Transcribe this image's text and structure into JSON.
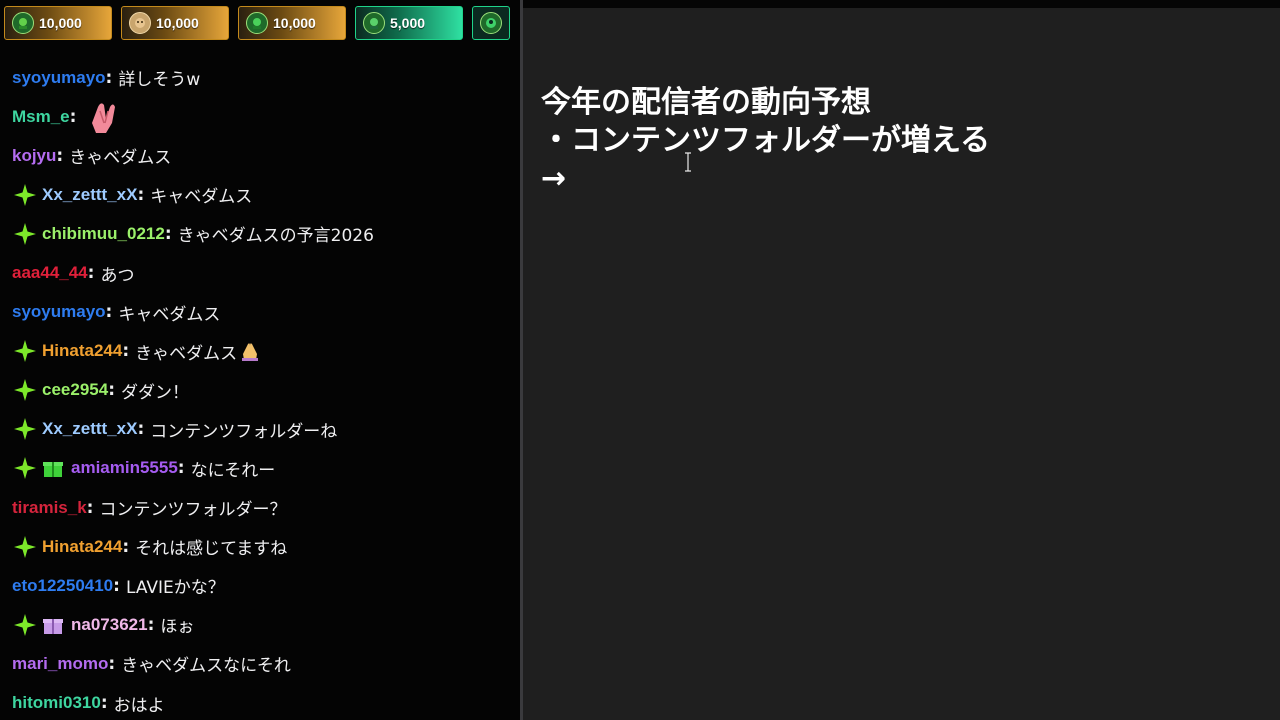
{
  "leaderboard": [
    {
      "count": "10,000",
      "style": "gold"
    },
    {
      "count": "10,000",
      "style": "gold"
    },
    {
      "count": "10,000",
      "style": "gold"
    },
    {
      "count": "5,000",
      "style": "green"
    }
  ],
  "messages": [
    {
      "user": "syoyumayo",
      "color": "#2e7cf0",
      "text": "詳しそうw",
      "badge": false,
      "gift": null
    },
    {
      "user": "Msm_e",
      "color": "#3ed6a0",
      "text": "",
      "badge": false,
      "gift": null,
      "emote": "praying-hands-emote"
    },
    {
      "user": "kojyu",
      "color": "#b46cf0",
      "text": "きゃベダムス",
      "badge": false,
      "gift": null
    },
    {
      "user": "Xx_zettt_xX",
      "color": "#9ecbff",
      "text": "キャベダムス",
      "badge": true,
      "gift": null
    },
    {
      "user": "chibimuu_0212",
      "color": "#9bf06a",
      "text": "きゃベダムスの予言2026",
      "badge": true,
      "gift": null
    },
    {
      "user": "aaa44_44",
      "color": "#e0203a",
      "text": "あつ",
      "badge": false,
      "gift": null
    },
    {
      "user": "syoyumayo",
      "color": "#2e7cf0",
      "text": "キャベダムス",
      "badge": false,
      "gift": null
    },
    {
      "user": "Hinata244",
      "color": "#f0a030",
      "text": "きゃベダムス",
      "badge": true,
      "gift": null,
      "small_emote": "pray-emoji"
    },
    {
      "user": "cee2954",
      "color": "#9bf06a",
      "text": "ダダン！",
      "badge": true,
      "gift": null
    },
    {
      "user": "Xx_zettt_xX",
      "color": "#9ecbff",
      "text": "コンテンツフォルダーね",
      "badge": true,
      "gift": null
    },
    {
      "user": "amiamin5555",
      "color": "#a55cf0",
      "text": "なにそれー",
      "badge": true,
      "gift": "green"
    },
    {
      "user": "tiramis_k",
      "color": "#d4243c",
      "text": "コンテンツフォルダー？",
      "badge": false,
      "gift": null
    },
    {
      "user": "Hinata244",
      "color": "#f0a030",
      "text": "それは感じてますね",
      "badge": true,
      "gift": null
    },
    {
      "user": "eto12250410",
      "color": "#2e7cf0",
      "text": "LAVIEかな？",
      "badge": false,
      "gift": null
    },
    {
      "user": "na073621",
      "color": "#f0b8e8",
      "text": "ほぉ",
      "badge": true,
      "gift": "purple"
    },
    {
      "user": "mari_momo",
      "color": "#b46cf0",
      "text": "きゃベダムスなにそれ",
      "badge": false,
      "gift": null
    },
    {
      "user": "hitomi0310",
      "color": "#3ed6a0",
      "text": "おはよ",
      "badge": false,
      "gift": null
    }
  ],
  "note": {
    "line1": "今年の配信者の動向予想",
    "line2": "・コンテンツフォルダーが増える",
    "line3": "→"
  },
  "colors": {
    "badge_green": "#7de82a",
    "gift_green": "#3fd23a",
    "gift_purple": "#c79be8"
  }
}
